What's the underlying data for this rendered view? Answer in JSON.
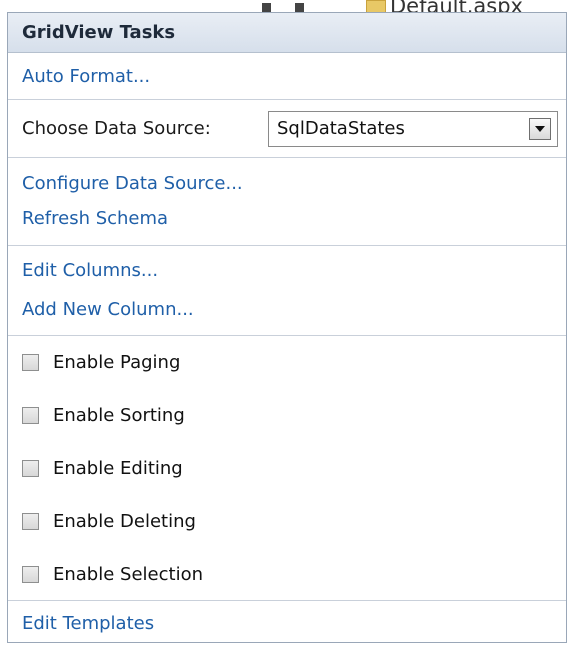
{
  "background": {
    "fragment_text": "Default.aspx"
  },
  "panel": {
    "title": "GridView Tasks",
    "auto_format": "Auto Format...",
    "choose_ds_label": "Choose Data Source:",
    "data_source_value": "SqlDataStates",
    "configure_ds": "Configure Data Source...",
    "refresh_schema": "Refresh Schema",
    "edit_columns": "Edit Columns...",
    "add_new_column": "Add New Column...",
    "checkboxes": [
      {
        "label": "Enable Paging",
        "checked": false
      },
      {
        "label": "Enable Sorting",
        "checked": false
      },
      {
        "label": "Enable Editing",
        "checked": false
      },
      {
        "label": "Enable Deleting",
        "checked": false
      },
      {
        "label": "Enable Selection",
        "checked": false
      }
    ],
    "edit_templates": "Edit Templates"
  },
  "colors": {
    "link": "#1f5fa8",
    "header_bg": "#dfe6ef",
    "border": "#9aa7b8"
  }
}
